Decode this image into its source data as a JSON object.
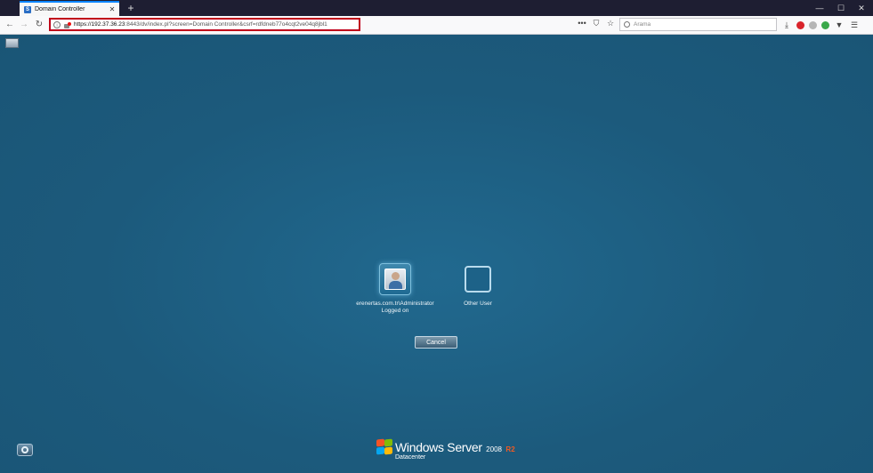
{
  "browser": {
    "tab_title": "Domain Controller",
    "tab_favicon_letter": "S",
    "new_tab_symbol": "+",
    "close_tab_symbol": "✕",
    "window_controls": {
      "minimize": "—",
      "maximize": "☐",
      "close": "✕"
    },
    "url_host": "https://192.37.36.23",
    "url_rest": ":8443/dv/index.pl?screen=Domain Controller&csrf=rdfdneb77o4cqt2ve04q8jbl1",
    "search_placeholder": "Arama",
    "page_actions": [
      "•••",
      "⛉",
      "☆"
    ],
    "toolbar_icons": [
      "download-icon",
      "adblock-icon",
      "extension-gray-icon",
      "extension-green-icon",
      "vpn-icon",
      "menu-icon"
    ]
  },
  "login_screen": {
    "tiles": [
      {
        "label_line1": "erenertas.com.tr\\Administrator",
        "label_line2": "Logged on",
        "selected": true
      },
      {
        "label_line1": "Other User",
        "label_line2": "",
        "selected": false
      }
    ],
    "cancel_label": "Cancel",
    "brand": {
      "name": "Windows Server",
      "version": "2008",
      "release": "R2",
      "edition": "Datacenter"
    }
  },
  "colors": {
    "background": "#1c5a7c",
    "url_highlight_border": "#c0001a",
    "tab_accent": "#0a84ff"
  }
}
